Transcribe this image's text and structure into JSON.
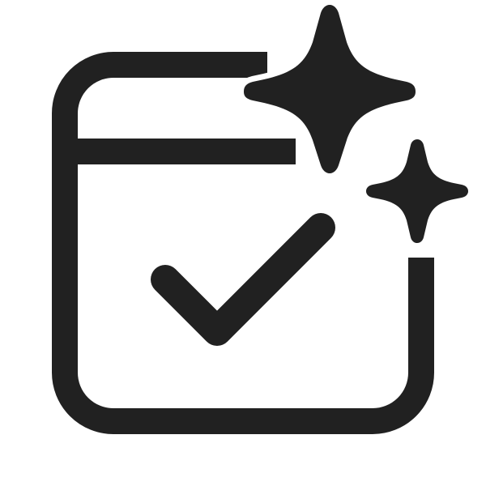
{
  "icon": {
    "name": "calendar-check-sparkle-icon",
    "parts": [
      "calendar-frame",
      "header-bar",
      "checkmark",
      "large-sparkle",
      "small-sparkle"
    ],
    "colors": {
      "stroke": "#212121",
      "background": "#ffffff"
    }
  }
}
